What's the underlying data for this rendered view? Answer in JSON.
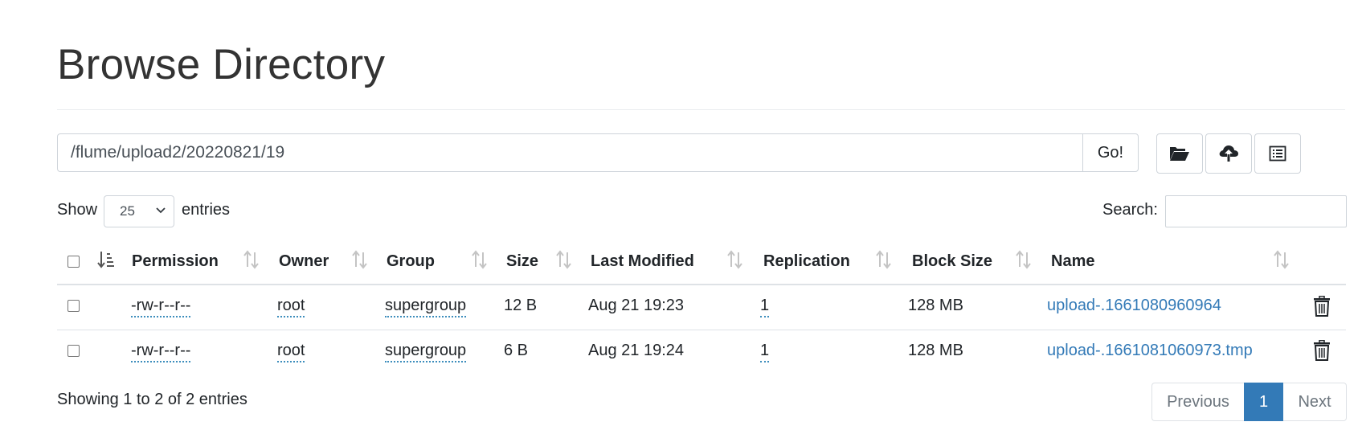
{
  "page": {
    "title": "Browse Directory"
  },
  "path_bar": {
    "value": "/flume/upload2/20220821/19",
    "go_label": "Go!"
  },
  "toolbar": {
    "buttons": [
      {
        "icon": "folder-open-icon"
      },
      {
        "icon": "cloud-upload-icon"
      },
      {
        "icon": "list-icon"
      }
    ]
  },
  "controls": {
    "show_label": "Show",
    "page_length": "25",
    "entries_label": "entries",
    "search_label": "Search:",
    "search_value": ""
  },
  "table": {
    "columns": [
      "Permission",
      "Owner",
      "Group",
      "Size",
      "Last Modified",
      "Replication",
      "Block Size",
      "Name"
    ],
    "rows": [
      {
        "permission": "-rw-r--r--",
        "owner": "root",
        "group": "supergroup",
        "size": "12 B",
        "modified": "Aug 21 19:23",
        "replication": "1",
        "block_size": "128 MB",
        "name": "upload-.1661080960964"
      },
      {
        "permission": "-rw-r--r--",
        "owner": "root",
        "group": "supergroup",
        "size": "6 B",
        "modified": "Aug 21 19:24",
        "replication": "1",
        "block_size": "128 MB",
        "name": "upload-.1661081060973.tmp"
      }
    ]
  },
  "footer": {
    "info": "Showing 1 to 2 of 2 entries",
    "previous": "Previous",
    "current_page": "1",
    "next": "Next"
  },
  "colors": {
    "link": "#337ab7",
    "active_page": "#337ab7",
    "border": "#dee2e6"
  }
}
